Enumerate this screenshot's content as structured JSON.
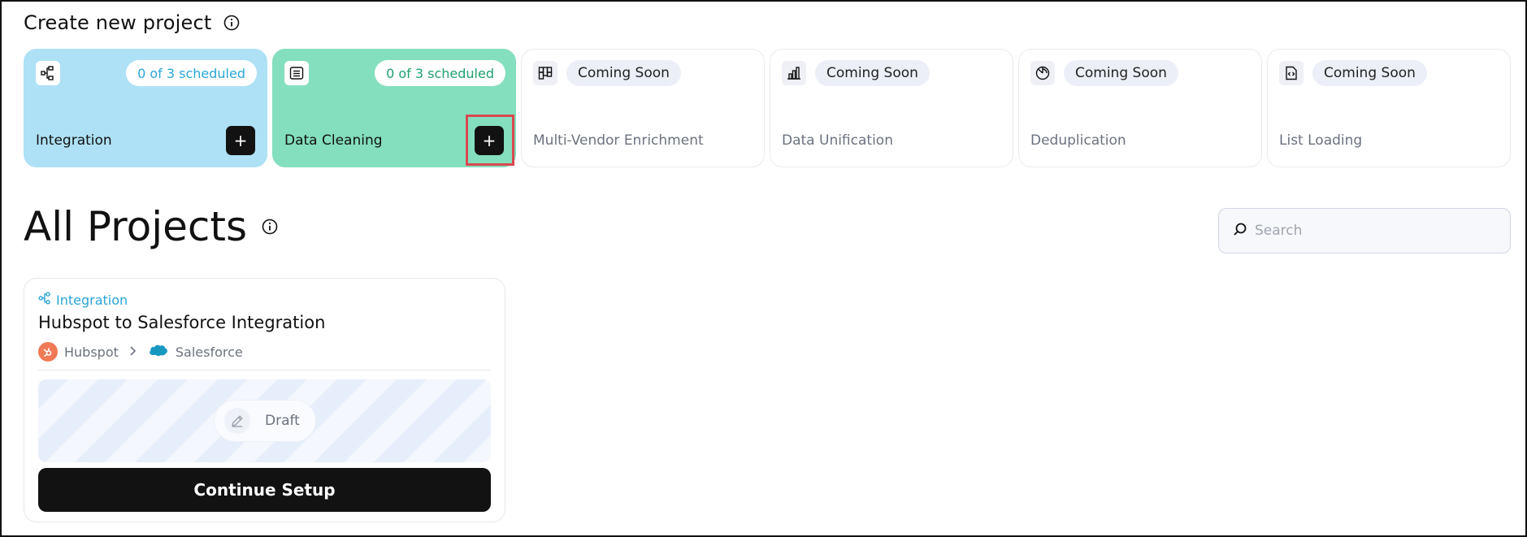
{
  "create": {
    "title": "Create new project",
    "info_icon": "info-circle-icon",
    "cards": [
      {
        "label": "Integration",
        "badge": "0 of 3 scheduled",
        "icon": "integration-flow-icon",
        "color": "#aee1f6"
      },
      {
        "label": "Data Cleaning",
        "badge": "0 of 3 scheduled",
        "icon": "document-lines-icon",
        "color": "#84dfbe"
      },
      {
        "label": "Multi-Vendor Enrichment",
        "badge": "Coming Soon",
        "icon": "grid-blocks-icon"
      },
      {
        "label": "Data Unification",
        "badge": "Coming Soon",
        "icon": "bar-chart-icon"
      },
      {
        "label": "Deduplication",
        "badge": "Coming Soon",
        "icon": "pie-chart-icon"
      },
      {
        "label": "List Loading",
        "badge": "Coming Soon",
        "icon": "code-file-icon"
      }
    ],
    "add_symbol": "+"
  },
  "projects": {
    "title": "All Projects",
    "search_placeholder": "Search",
    "items": [
      {
        "type": "Integration",
        "name": "Hubspot to Salesforce Integration",
        "source": "Hubspot",
        "destination": "Salesforce",
        "status": "Draft",
        "action": "Continue Setup"
      }
    ]
  },
  "colors": {
    "integration": "#aee1f6",
    "cleaning": "#84dfbe",
    "accent_blue": "#2aa6d8",
    "accent_green": "#1fa06c",
    "highlight": "#d9484f"
  }
}
